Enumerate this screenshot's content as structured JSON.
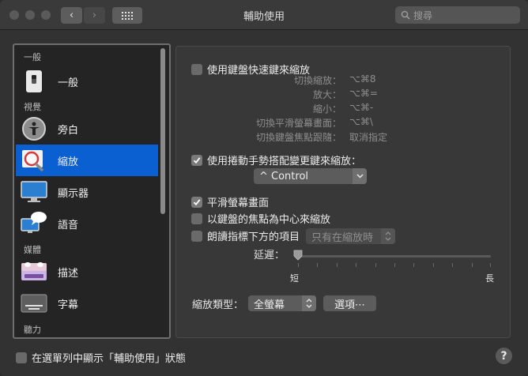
{
  "window": {
    "title": "輔助使用"
  },
  "toolbar": {
    "back_glyph": "‹",
    "forward_glyph": "›",
    "search_placeholder": "搜尋"
  },
  "sidebar": {
    "sections": [
      "一般",
      "視覺",
      "媒體",
      "聽力"
    ],
    "items": [
      {
        "label": "一般",
        "icon": "switch-icon"
      },
      {
        "label": "旁白",
        "icon": "voiceover-icon"
      },
      {
        "label": "縮放",
        "icon": "zoom-icon",
        "selected": true
      },
      {
        "label": "顯示器",
        "icon": "display-icon"
      },
      {
        "label": "語音",
        "icon": "speech-icon"
      },
      {
        "label": "描述",
        "icon": "descriptions-icon"
      },
      {
        "label": "字幕",
        "icon": "captions-icon"
      }
    ]
  },
  "zoom": {
    "keyboard_shortcuts": {
      "label": "使用鍵盤快速鍵來縮放",
      "checked": false
    },
    "shortcuts": [
      {
        "name": "切換縮放：",
        "keys": "⌥⌘8"
      },
      {
        "name": "放大：",
        "keys": "⌥⌘="
      },
      {
        "name": "縮小：",
        "keys": "⌥⌘-"
      },
      {
        "name": "切換平滑螢幕畫面：",
        "keys": "⌥⌘\\"
      },
      {
        "name": "切換鍵盤焦點跟隨：",
        "keys": "取消指定"
      }
    ],
    "scroll_gesture": {
      "label": "使用捲動手勢搭配變更鍵來縮放：",
      "checked": true
    },
    "modifier_select": "^ Control",
    "smooth_images": {
      "label": "平滑螢幕畫面",
      "checked": true
    },
    "follow_focus": {
      "label": "以鍵盤的焦點為中心來縮放",
      "checked": false
    },
    "speak_items": {
      "label": "朗讀指標下方的項目",
      "checked": false
    },
    "speak_select": "只有在縮放時",
    "delay": {
      "label": "延遲：",
      "min_label": "短",
      "max_label": "長",
      "value": 0
    },
    "style": {
      "label": "縮放類型：",
      "value": "全螢幕"
    },
    "options_button": "選項⋯"
  },
  "footer": {
    "menu_bar_status": {
      "label": "在選單列中顯示「輔助使用」狀態",
      "checked": false
    },
    "help": "?"
  }
}
